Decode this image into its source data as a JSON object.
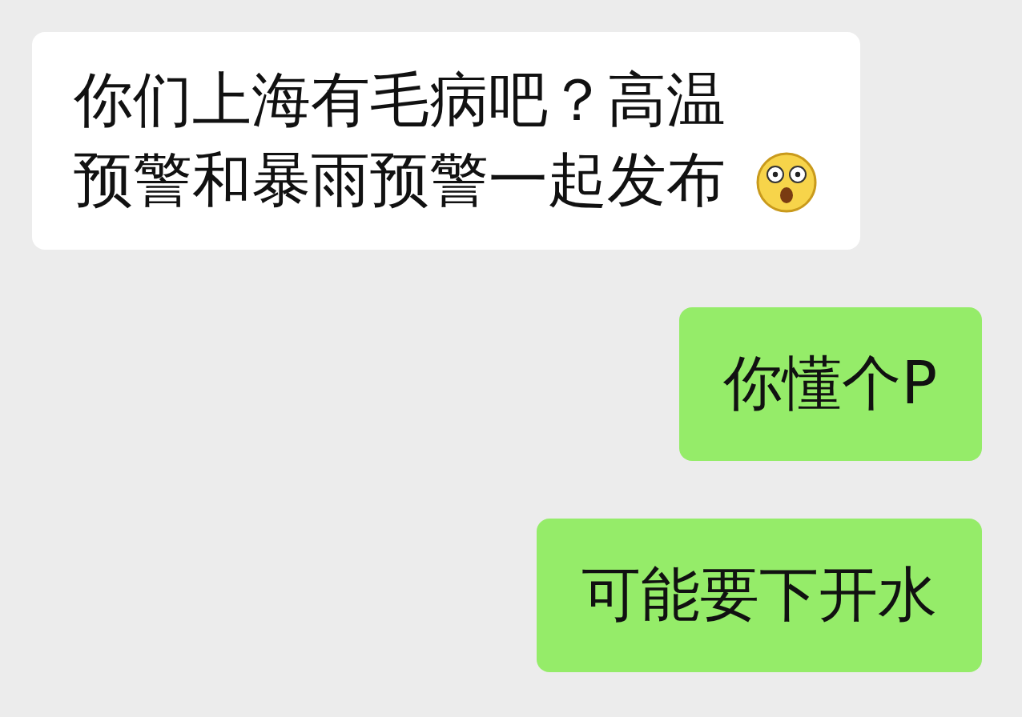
{
  "messages": [
    {
      "kind": "received",
      "text": "你们上海有毛病吧？高温预警和暴雨预警一起发布",
      "emoji": true
    },
    {
      "kind": "sent",
      "text": "你懂个P",
      "emoji": false
    },
    {
      "kind": "sent",
      "text": "可能要下开水",
      "emoji": false
    }
  ]
}
